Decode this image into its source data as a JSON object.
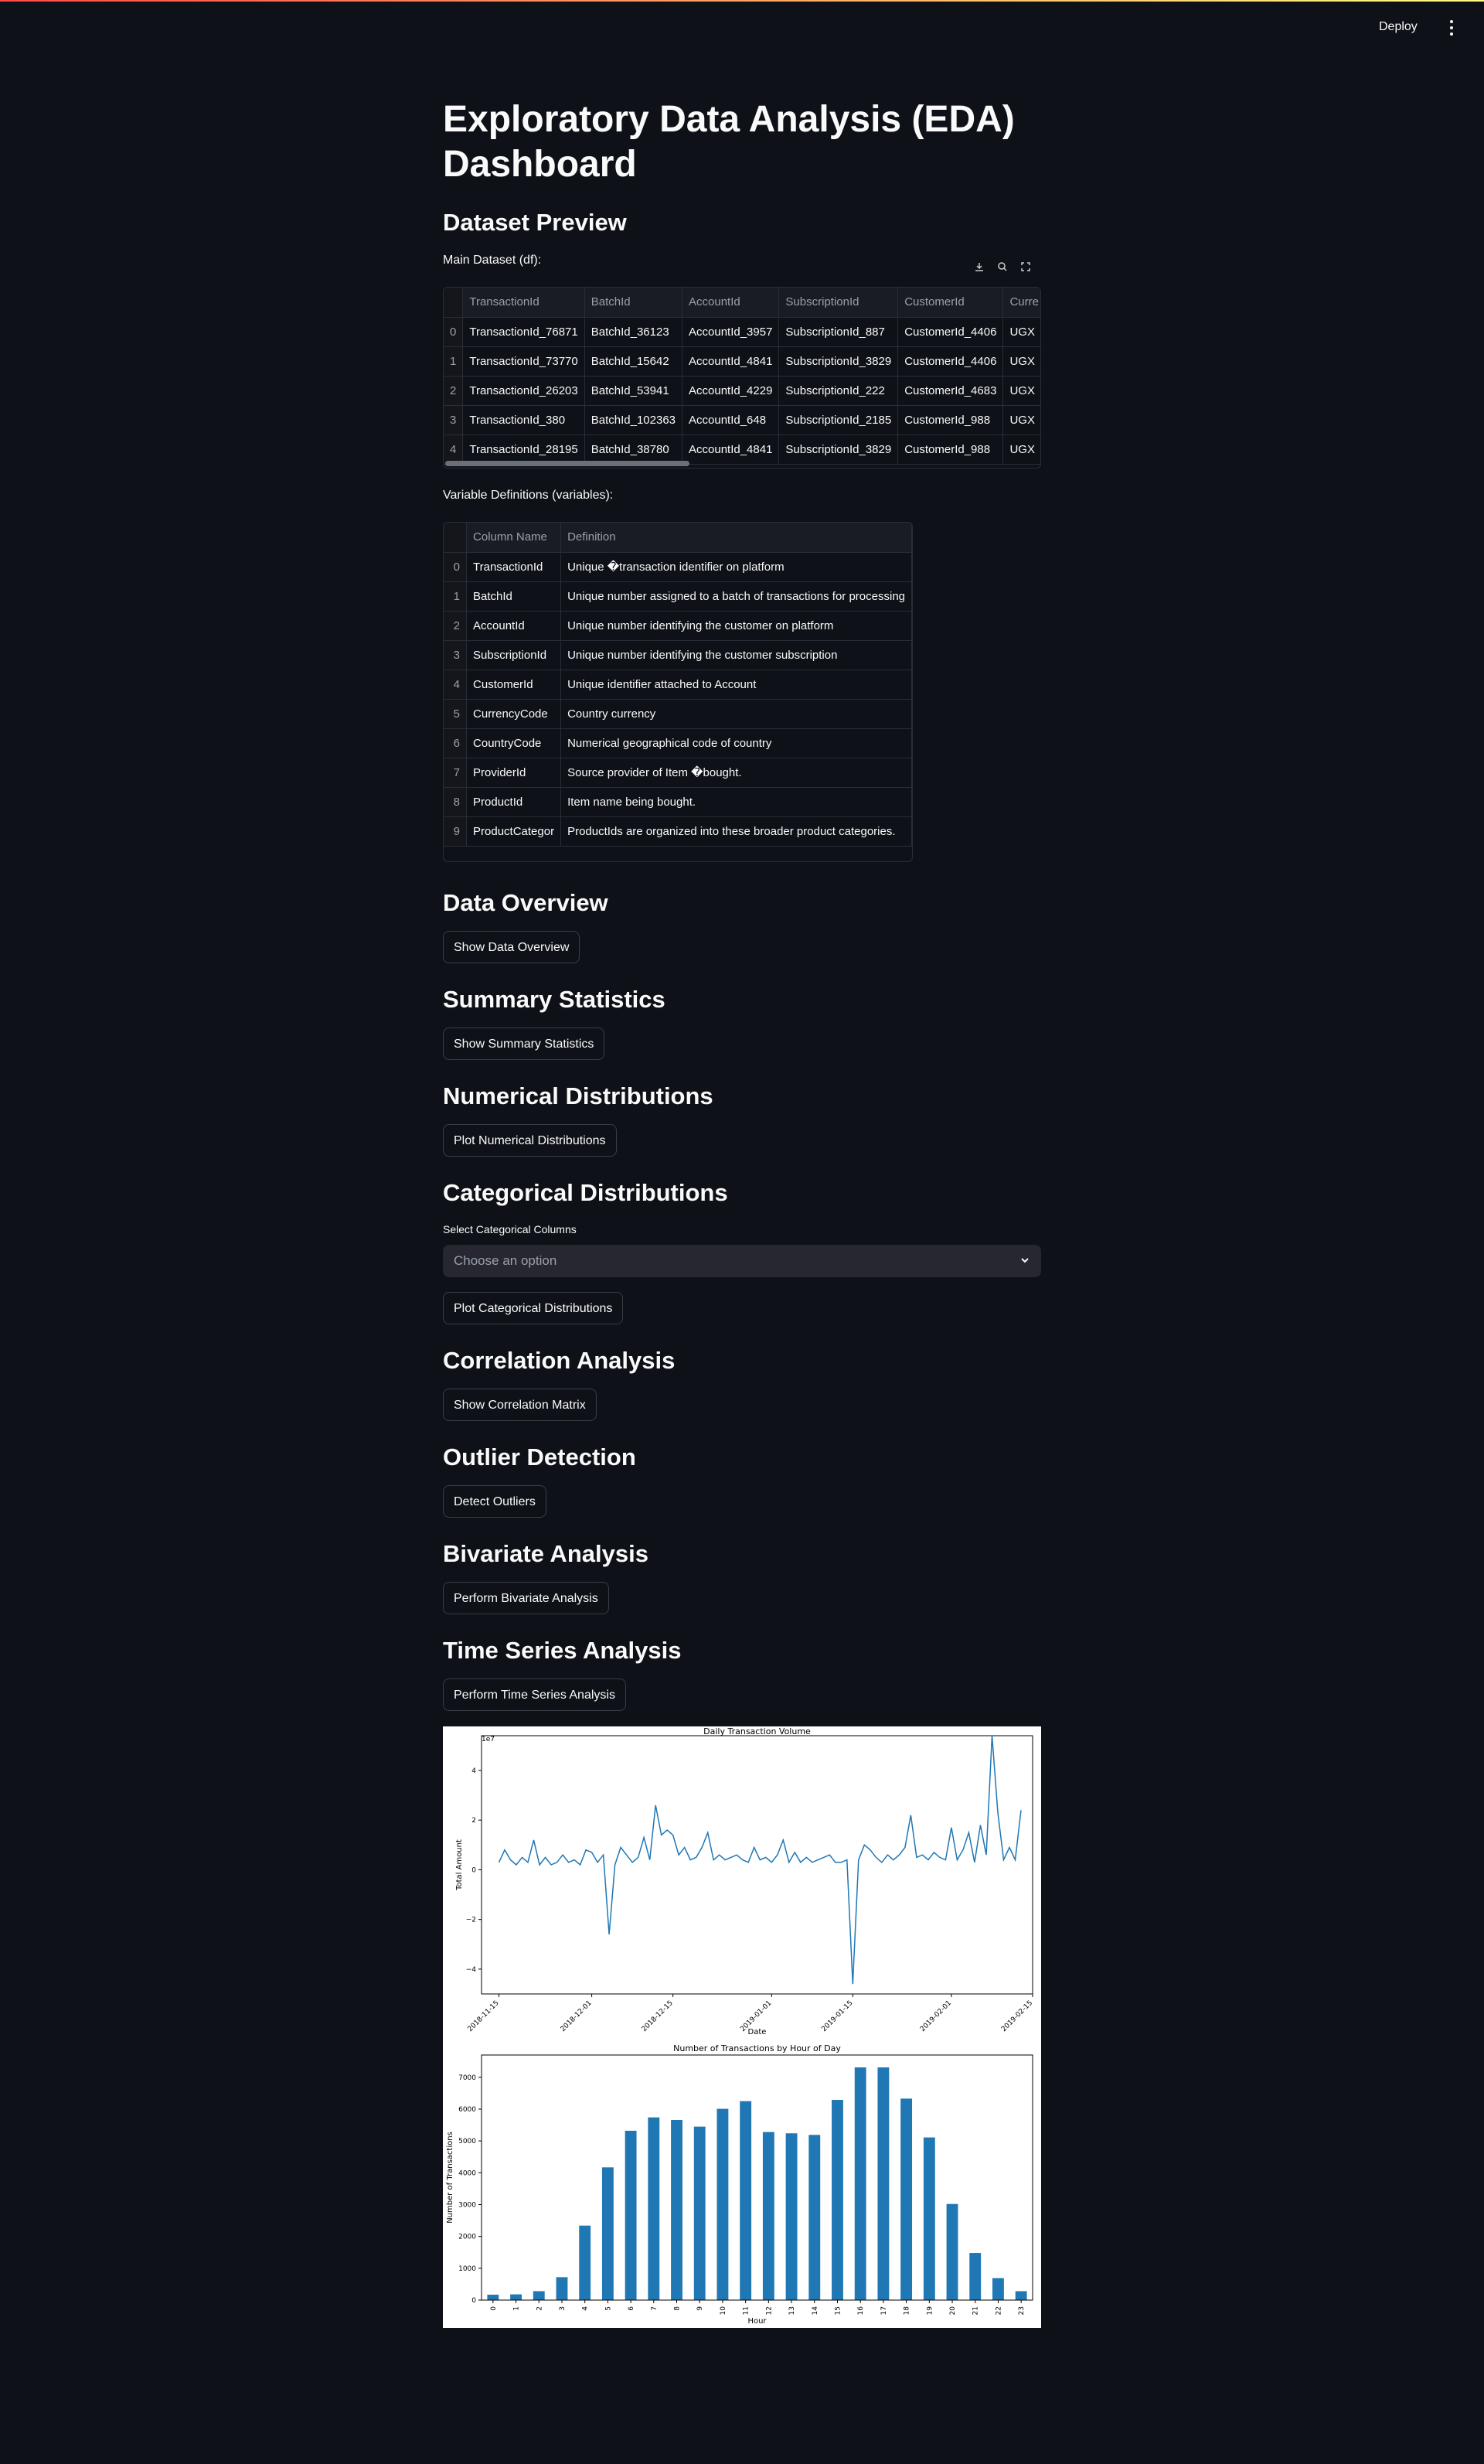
{
  "header": {
    "deploy_label": "Deploy",
    "menu_icon": "more-vertical-icon"
  },
  "page": {
    "title": "Exploratory Data Analysis (EDA) Dashboard"
  },
  "preview": {
    "heading": "Dataset Preview",
    "main_label": "Main Dataset (df):",
    "toolbar_icons": [
      "download-icon",
      "search-icon",
      "fullscreen-icon"
    ],
    "main_table": {
      "columns": [
        "",
        "TransactionId",
        "BatchId",
        "AccountId",
        "SubscriptionId",
        "CustomerId",
        "Curre"
      ],
      "rows": [
        [
          "0",
          "TransactionId_76871",
          "BatchId_36123",
          "AccountId_3957",
          "SubscriptionId_887",
          "CustomerId_4406",
          "UGX"
        ],
        [
          "1",
          "TransactionId_73770",
          "BatchId_15642",
          "AccountId_4841",
          "SubscriptionId_3829",
          "CustomerId_4406",
          "UGX"
        ],
        [
          "2",
          "TransactionId_26203",
          "BatchId_53941",
          "AccountId_4229",
          "SubscriptionId_222",
          "CustomerId_4683",
          "UGX"
        ],
        [
          "3",
          "TransactionId_380",
          "BatchId_102363",
          "AccountId_648",
          "SubscriptionId_2185",
          "CustomerId_988",
          "UGX"
        ],
        [
          "4",
          "TransactionId_28195",
          "BatchId_38780",
          "AccountId_4841",
          "SubscriptionId_3829",
          "CustomerId_988",
          "UGX"
        ]
      ]
    },
    "vars_label": "Variable Definitions (variables):",
    "vars_table": {
      "columns": [
        "",
        "Column Name",
        "Definition"
      ],
      "rows": [
        [
          "0",
          "TransactionId",
          "Unique �transaction identifier on platform"
        ],
        [
          "1",
          "BatchId",
          "Unique number assigned to a batch of transactions for processing"
        ],
        [
          "2",
          "AccountId",
          "Unique number identifying the customer on platform"
        ],
        [
          "3",
          "SubscriptionId",
          "Unique number identifying the customer subscription"
        ],
        [
          "4",
          "CustomerId",
          "Unique identifier attached to Account"
        ],
        [
          "5",
          "CurrencyCode",
          "Country currency"
        ],
        [
          "6",
          "CountryCode",
          "Numerical geographical code of country"
        ],
        [
          "7",
          "ProviderId",
          "Source provider of Item �bought."
        ],
        [
          "8",
          "ProductId",
          "Item name being bought."
        ],
        [
          "9",
          "ProductCategor",
          "ProductIds are organized into these broader product categories."
        ]
      ]
    }
  },
  "sections": {
    "overview": {
      "heading": "Data Overview",
      "button": "Show Data Overview"
    },
    "summary": {
      "heading": "Summary Statistics",
      "button": "Show Summary Statistics"
    },
    "numerical": {
      "heading": "Numerical Distributions",
      "button": "Plot Numerical Distributions"
    },
    "categorical": {
      "heading": "Categorical Distributions",
      "select_label": "Select Categorical Columns",
      "select_placeholder": "Choose an option",
      "button": "Plot Categorical Distributions"
    },
    "correlation": {
      "heading": "Correlation Analysis",
      "button": "Show Correlation Matrix"
    },
    "outlier": {
      "heading": "Outlier Detection",
      "button": "Detect Outliers"
    },
    "bivariate": {
      "heading": "Bivariate Analysis",
      "button": "Perform Bivariate Analysis"
    },
    "timeseries": {
      "heading": "Time Series Analysis",
      "button": "Perform Time Series Analysis"
    }
  },
  "colors": {
    "line": "#1f77b4",
    "bar": "#1f77b4",
    "background": "#0e1117"
  },
  "chart_data": [
    {
      "type": "line",
      "title": "Daily Transaction Volume",
      "xlabel": "Date",
      "ylabel": "Total Amount",
      "y_offset_label": "1e7",
      "x_ticks": [
        "2018-11-15",
        "2018-12-01",
        "2018-12-15",
        "2019-01-01",
        "2019-01-15",
        "2019-02-01",
        "2019-02-15"
      ],
      "y_ticks": [
        -4,
        -2,
        0,
        2,
        4
      ],
      "xlim": [
        "2018-11-12",
        "2019-02-15"
      ],
      "ylim": [
        -5,
        5.4
      ],
      "series": [
        {
          "x": [
            "2018-11-15",
            "2018-11-16",
            "2018-11-17",
            "2018-11-18",
            "2018-11-19",
            "2018-11-20",
            "2018-11-21",
            "2018-11-22",
            "2018-11-23",
            "2018-11-24",
            "2018-11-25",
            "2018-11-26",
            "2018-11-27",
            "2018-11-28",
            "2018-11-29",
            "2018-11-30",
            "2018-12-01",
            "2018-12-02",
            "2018-12-03",
            "2018-12-04",
            "2018-12-05",
            "2018-12-06",
            "2018-12-07",
            "2018-12-08",
            "2018-12-09",
            "2018-12-10",
            "2018-12-11",
            "2018-12-12",
            "2018-12-13",
            "2018-12-14",
            "2018-12-15",
            "2018-12-16",
            "2018-12-17",
            "2018-12-18",
            "2018-12-19",
            "2018-12-20",
            "2018-12-21",
            "2018-12-22",
            "2018-12-23",
            "2018-12-24",
            "2018-12-25",
            "2018-12-26",
            "2018-12-27",
            "2018-12-28",
            "2018-12-29",
            "2018-12-30",
            "2018-12-31",
            "2019-01-01",
            "2019-01-02",
            "2019-01-03",
            "2019-01-04",
            "2019-01-05",
            "2019-01-06",
            "2019-01-07",
            "2019-01-08",
            "2019-01-09",
            "2019-01-10",
            "2019-01-11",
            "2019-01-12",
            "2019-01-13",
            "2019-01-14",
            "2019-01-15",
            "2019-01-16",
            "2019-01-17",
            "2019-01-18",
            "2019-01-19",
            "2019-01-20",
            "2019-01-21",
            "2019-01-22",
            "2019-01-23",
            "2019-01-24",
            "2019-01-25",
            "2019-01-26",
            "2019-01-27",
            "2019-01-28",
            "2019-01-29",
            "2019-01-30",
            "2019-01-31",
            "2019-02-01",
            "2019-02-02",
            "2019-02-03",
            "2019-02-04",
            "2019-02-05",
            "2019-02-06",
            "2019-02-07",
            "2019-02-08",
            "2019-02-09",
            "2019-02-10",
            "2019-02-11",
            "2019-02-12",
            "2019-02-13"
          ],
          "y": [
            0.3,
            0.8,
            0.4,
            0.2,
            0.5,
            0.3,
            1.2,
            0.2,
            0.5,
            0.2,
            0.3,
            0.6,
            0.3,
            0.4,
            0.2,
            0.8,
            0.7,
            0.3,
            0.6,
            -2.6,
            0.2,
            0.9,
            0.6,
            0.3,
            0.5,
            1.3,
            0.4,
            2.6,
            1.4,
            1.6,
            1.4,
            0.6,
            0.9,
            0.4,
            0.5,
            0.9,
            1.5,
            0.4,
            0.6,
            0.4,
            0.5,
            0.6,
            0.4,
            0.3,
            0.9,
            0.4,
            0.5,
            0.3,
            0.6,
            1.2,
            0.3,
            0.7,
            0.3,
            0.5,
            0.3,
            0.4,
            0.5,
            0.6,
            0.3,
            0.3,
            0.4,
            -4.6,
            0.4,
            1.0,
            0.8,
            0.5,
            0.3,
            0.6,
            0.4,
            0.6,
            0.9,
            2.2,
            0.5,
            0.6,
            0.4,
            0.7,
            0.5,
            0.4,
            1.7,
            0.4,
            0.8,
            1.5,
            0.3,
            1.8,
            0.6,
            5.4,
            2.3,
            0.4,
            0.9,
            0.4,
            2.4
          ]
        }
      ]
    },
    {
      "type": "bar",
      "title": "Number of Transactions by Hour of Day",
      "xlabel": "Hour",
      "ylabel": "Number of Transactions",
      "categories": [
        "0",
        "1",
        "2",
        "3",
        "4",
        "5",
        "6",
        "7",
        "8",
        "9",
        "10",
        "11",
        "12",
        "13",
        "14",
        "15",
        "16",
        "17",
        "18",
        "19",
        "20",
        "21",
        "22",
        "23"
      ],
      "values": [
        170,
        180,
        280,
        720,
        2340,
        4170,
        5320,
        5740,
        5660,
        5450,
        6010,
        6250,
        5280,
        5240,
        5190,
        6290,
        7310,
        7310,
        6330,
        5110,
        3020,
        1480,
        690,
        280
      ],
      "y_ticks": [
        0,
        1000,
        2000,
        3000,
        4000,
        5000,
        6000,
        7000
      ],
      "ylim": [
        0,
        7700
      ]
    }
  ]
}
